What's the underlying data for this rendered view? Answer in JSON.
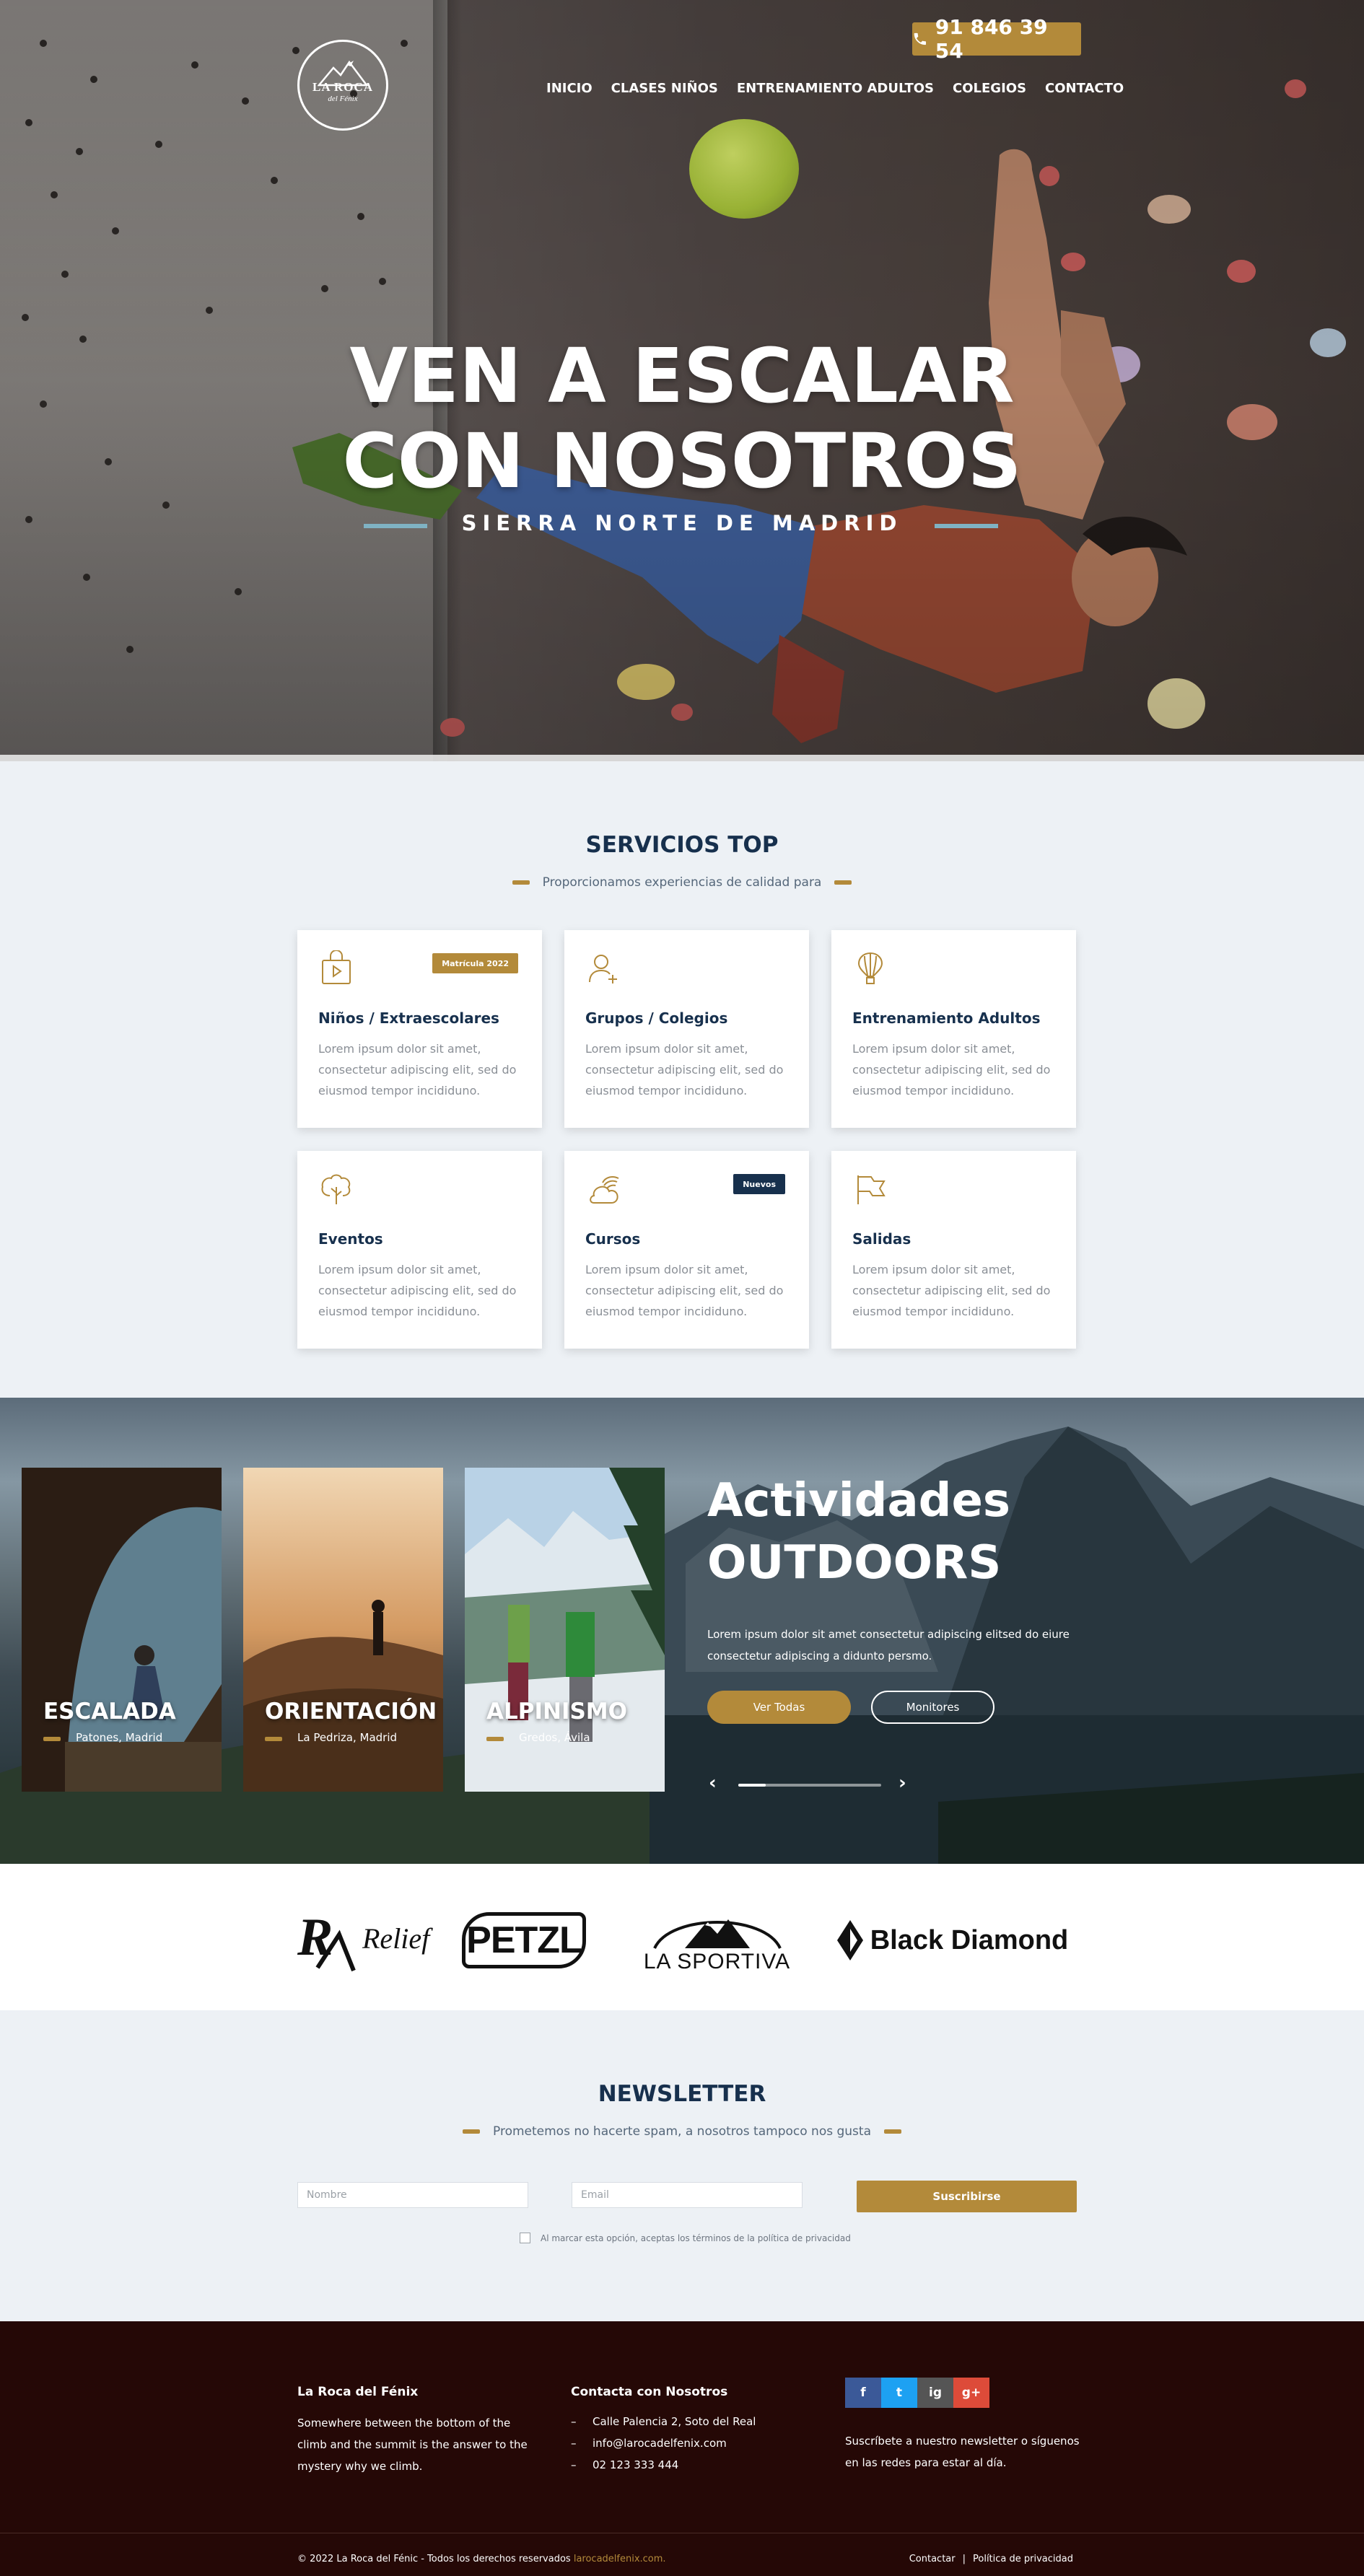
{
  "header": {
    "logo_line1": "LA ROCA",
    "logo_line2": "del Fénix",
    "phone": "91 846 39 54",
    "nav": [
      "INICIO",
      "CLASES NIÑOS",
      "ENTRENAMIENTO ADULTOS",
      "COLEGIOS",
      "CONTACTO"
    ]
  },
  "hero": {
    "title_line1": "VEN A ESCALAR",
    "title_line2": "CON NOSOTROS",
    "subtitle": "SIERRA NORTE DE MADRID"
  },
  "services": {
    "title": "SERVICIOS TOP",
    "subtitle": "Proporcionamos experiencias de calidad para",
    "cards": [
      {
        "title": "Niños / Extraescolares",
        "text": "Lorem ipsum dolor sit amet, consectetur adipiscing elit, sed do eiusmod tempor incididuno.",
        "icon": "bag-play-icon",
        "badge": "Matrícula 2022"
      },
      {
        "title": "Grupos / Colegios",
        "text": "Lorem ipsum dolor sit amet, consectetur adipiscing elit, sed do eiusmod tempor incididuno.",
        "icon": "user-add-icon",
        "badge": ""
      },
      {
        "title": "Entrenamiento Adultos",
        "text": "Lorem ipsum dolor sit amet, consectetur adipiscing elit, sed do eiusmod tempor incididuno.",
        "icon": "balloon-icon",
        "badge": ""
      },
      {
        "title": "Eventos",
        "text": "Lorem ipsum dolor sit amet, consectetur adipiscing elit, sed do eiusmod tempor incididuno.",
        "icon": "tree-icon",
        "badge": ""
      },
      {
        "title": "Cursos",
        "text": "Lorem ipsum dolor sit amet, consectetur adipiscing elit, sed do eiusmod tempor incididuno.",
        "icon": "cloud-sun-icon",
        "badge": "Nuevos"
      },
      {
        "title": "Salidas",
        "text": "Lorem ipsum dolor sit amet, consectetur adipiscing elit, sed do eiusmod tempor incididuno.",
        "icon": "flag-icon",
        "badge": ""
      }
    ],
    "badge_colors": {
      "gold": "#b38a3a",
      "navy": "#17304d"
    }
  },
  "outdoors": {
    "cards": [
      {
        "title": "ESCALADA",
        "place": "Patones, Madrid"
      },
      {
        "title": "ORIENTACIÓN",
        "place": "La Pedriza, Madrid"
      },
      {
        "title": "ALPINISMO",
        "place": "Gredos, Ávila"
      }
    ],
    "title_line1": "Actividades",
    "title_line2": "OUTDOORS",
    "description": "Lorem ipsum dolor sit amet consectetur adipiscing elitsed do eiure consectetur adipiscing a didunto persmo.",
    "btn_primary": "Ver Todas",
    "btn_secondary": "Monitores",
    "prev": "‹",
    "next": "›"
  },
  "brands": [
    "Relief",
    "PETZL",
    "LA SPORTIVA",
    "Black Diamond"
  ],
  "newsletter": {
    "title": "NEWSLETTER",
    "subtitle": "Prometemos no hacerte spam, a nosotros tampoco nos gusta",
    "name_placeholder": "Nombre",
    "email_placeholder": "Email",
    "button": "Suscribirse",
    "consent": "Al marcar esta opción, aceptas los términos de la política de privacidad"
  },
  "footer": {
    "about_title": "La Roca del Fénix",
    "about_text": "Somewhere between the bottom of the climb and the summit is the answer to the mystery why we climb.",
    "contact_title": "Contacta con Nosotros",
    "contact": [
      "Calle Palencia 2, Soto del Real",
      "info@larocadelfenix.com",
      "02 123 333 444"
    ],
    "social": [
      "f",
      "t",
      "ig",
      "g+"
    ],
    "social_colors": [
      "#3b5998",
      "#1da1f2",
      "#555555",
      "#dd4b39"
    ],
    "social_text": "Suscríbete a nuestro newsletter o síguenos en las redes para estar al día.",
    "copyright": "© 2022 La Roca del Fénic - Todos los derechos reservados",
    "copyright_link": "larocadelfenix.com.",
    "links": [
      "Contactar",
      "|",
      "Política de privacidad"
    ]
  }
}
